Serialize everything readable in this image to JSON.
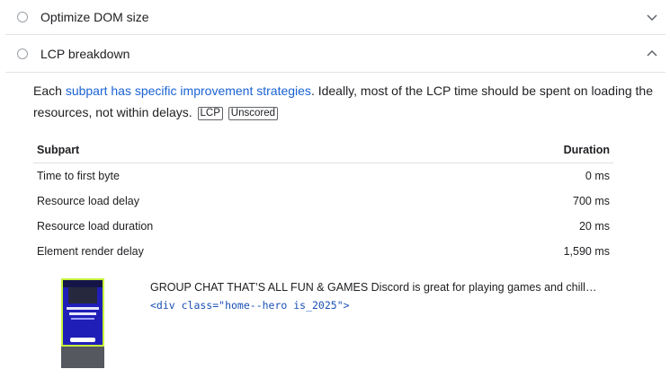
{
  "audits": [
    {
      "title": "Optimize DOM size",
      "expanded": false
    },
    {
      "title": "LCP breakdown",
      "expanded": true
    }
  ],
  "description": {
    "prefix": "Each ",
    "link": "subpart has specific improvement strategies",
    "suffix": ". Ideally, most of the LCP time should be spent on loading the resources, not within delays.",
    "tags": [
      "LCP",
      "Unscored"
    ]
  },
  "table": {
    "headers": [
      "Subpart",
      "Duration"
    ],
    "rows": [
      {
        "subpart": "Time to first byte",
        "duration": "0 ms"
      },
      {
        "subpart": "Resource load delay",
        "duration": "700 ms"
      },
      {
        "subpart": "Resource load duration",
        "duration": "20 ms"
      },
      {
        "subpart": "Element render delay",
        "duration": "1,590 ms"
      }
    ]
  },
  "node": {
    "snippet": "GROUP CHAT THAT’S ALL FUN & GAMES Discord is great for playing games and chill…",
    "code": "<div class=\"home--hero is_2025\">"
  },
  "colors": {
    "link": "#1a62d3",
    "highlight": "#c6f23b",
    "code": "#1a4fb5"
  }
}
